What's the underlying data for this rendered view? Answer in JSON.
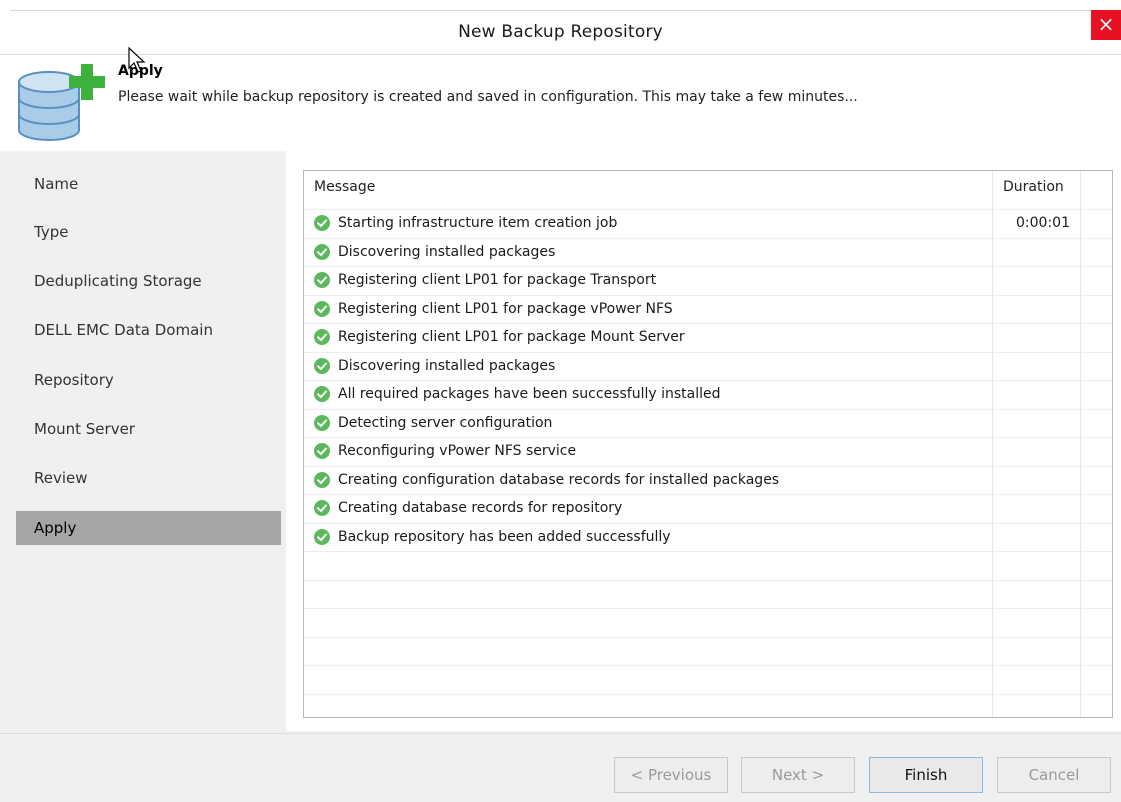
{
  "window": {
    "title": "New Backup Repository",
    "close_label": "×"
  },
  "header": {
    "step_title": "Apply",
    "description": "Please wait while backup repository is created and saved in configuration. This may take a few minutes...",
    "icon": "database-add-icon"
  },
  "nav": {
    "items": [
      {
        "label": "Name"
      },
      {
        "label": "Type"
      },
      {
        "label": "Deduplicating Storage"
      },
      {
        "label": "DELL EMC Data Domain"
      },
      {
        "label": "Repository"
      },
      {
        "label": "Mount Server"
      },
      {
        "label": "Review"
      },
      {
        "label": "Apply"
      }
    ],
    "active": "Apply"
  },
  "log": {
    "columns": [
      "Message",
      "Duration"
    ],
    "rows": [
      {
        "message": "Starting infrastructure item creation job",
        "duration": "0:00:01",
        "status": "success"
      },
      {
        "message": "Discovering installed packages",
        "duration": "",
        "status": "success"
      },
      {
        "message": "Registering client LP01 for package Transport",
        "duration": "",
        "status": "success"
      },
      {
        "message": "Registering client LP01 for package vPower NFS",
        "duration": "",
        "status": "success"
      },
      {
        "message": "Registering client LP01 for package Mount Server",
        "duration": "",
        "status": "success"
      },
      {
        "message": "Discovering installed packages",
        "duration": "",
        "status": "success"
      },
      {
        "message": "All required packages have been successfully installed",
        "duration": "",
        "status": "success"
      },
      {
        "message": "Detecting server configuration",
        "duration": "",
        "status": "success"
      },
      {
        "message": "Reconfiguring vPower NFS service",
        "duration": "",
        "status": "success"
      },
      {
        "message": "Creating configuration database records for installed packages",
        "duration": "",
        "status": "success"
      },
      {
        "message": "Creating database records for repository",
        "duration": "",
        "status": "success"
      },
      {
        "message": "Backup repository has been added successfully",
        "duration": "",
        "status": "success"
      }
    ]
  },
  "footer": {
    "previous_label": "< Previous",
    "next_label": "Next >",
    "finish_label": "Finish",
    "cancel_label": "Cancel"
  },
  "colors": {
    "success": "#5cb85c",
    "close": "#e81123",
    "nav_active": "#a6a6a6",
    "db_icon": "#7fb2d8",
    "plus_icon": "#3cb23c"
  }
}
